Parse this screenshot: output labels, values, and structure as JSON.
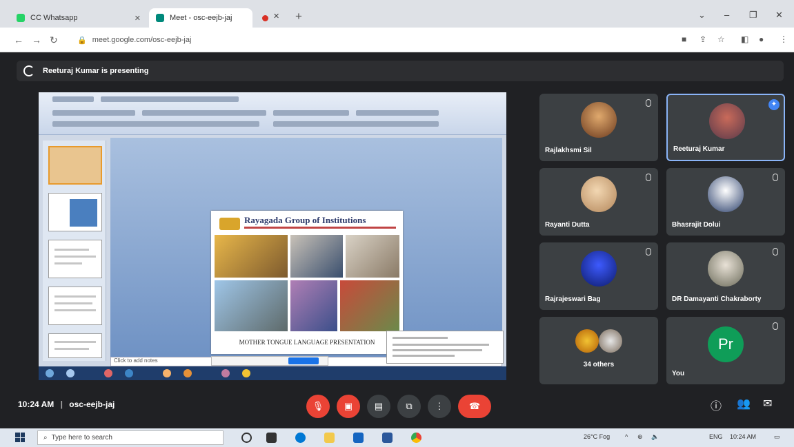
{
  "browser": {
    "tabs": [
      {
        "label": "CC Whatsapp",
        "active": false
      },
      {
        "label": "Meet - osc-eejb-jaj",
        "active": true
      }
    ],
    "url": "meet.google.com/osc-eejb-jaj"
  },
  "meet": {
    "presenting_banner": "Reeturaj Kumar is presenting",
    "time": "10:24 AM",
    "meeting_code": "osc-eejb-jaj"
  },
  "shared_screen": {
    "slide_title": "Rayagada Group of Institutions",
    "slide_caption": "MOTHER TONGUE LANGUAGE PRESENTATION",
    "notes_placeholder": "Click to add notes"
  },
  "participants": [
    {
      "name": "Rajlakhsmi Sil",
      "avatar": "photo"
    },
    {
      "name": "Reeturaj Kumar",
      "avatar": "photo",
      "pinned": true
    },
    {
      "name": "Rayanti Dutta",
      "avatar": "photo"
    },
    {
      "name": "Bhasrajit Dolui",
      "avatar": "photo"
    },
    {
      "name": "Rajrajeswari Bag",
      "avatar": "photo"
    },
    {
      "name": "DR Damayanti Chakraborty",
      "avatar": "photo"
    },
    {
      "name": "34 others",
      "avatar": "group"
    },
    {
      "name": "You",
      "avatar": "initials",
      "initials": "Pr"
    }
  ],
  "taskbar": {
    "search_placeholder": "Type here to search",
    "weather": "26°C Fog",
    "lang": "ENG",
    "clock_time": "10:24 AM"
  },
  "colors": {
    "meet_bg": "#202124",
    "tile_bg": "#3c4043",
    "red_button": "#ea4335",
    "pin": "#4285f4",
    "you_avatar": "#0f9d58"
  }
}
